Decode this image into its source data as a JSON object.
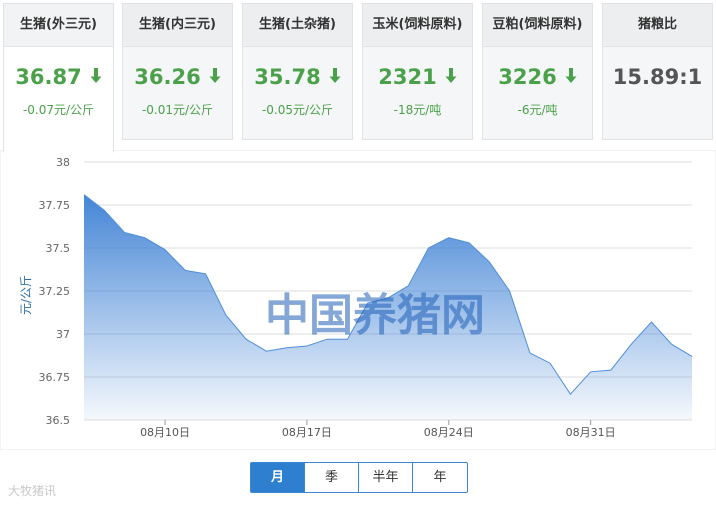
{
  "cards": [
    {
      "title": "生猪(外三元)",
      "value": "36.87",
      "change": "-0.07元/公斤",
      "direction": "down",
      "active": true
    },
    {
      "title": "生猪(内三元)",
      "value": "36.26",
      "change": "-0.01元/公斤",
      "direction": "down"
    },
    {
      "title": "生猪(土杂猪)",
      "value": "35.78",
      "change": "-0.05元/公斤",
      "direction": "down"
    },
    {
      "title": "玉米(饲料原料)",
      "value": "2321",
      "change": "-18元/吨",
      "direction": "down"
    },
    {
      "title": "豆粕(饲料原料)",
      "value": "3226",
      "change": "-6元/吨",
      "direction": "down"
    },
    {
      "title": "猪粮比",
      "ratio": "15.89:1"
    }
  ],
  "colors": {
    "down": "#4aa14a",
    "accent": "#2e7fd0",
    "area_top": "#3b7fd4"
  },
  "chart_data": {
    "type": "area",
    "ylabel": "元/公斤",
    "ylim": [
      36.5,
      38
    ],
    "yticks": [
      "36.5",
      "36.75",
      "37",
      "37.25",
      "37.5",
      "37.75",
      "38"
    ],
    "xticks": [
      {
        "label": "08月10日",
        "x": 5
      },
      {
        "label": "08月17日",
        "x": 12
      },
      {
        "label": "08月24日",
        "x": 19
      },
      {
        "label": "08月31日",
        "x": 26
      }
    ],
    "x": [
      1,
      2,
      3,
      4,
      5,
      6,
      7,
      8,
      9,
      10,
      11,
      12,
      13,
      14,
      15,
      16,
      17,
      18,
      19,
      20,
      21,
      22,
      23,
      24,
      25,
      26,
      27,
      28,
      29,
      30,
      31
    ],
    "values": [
      37.81,
      37.72,
      37.59,
      37.56,
      37.49,
      37.37,
      37.35,
      37.11,
      36.97,
      36.9,
      36.92,
      36.93,
      36.97,
      36.97,
      37.18,
      37.21,
      37.28,
      37.5,
      37.56,
      37.53,
      37.42,
      37.25,
      36.89,
      36.83,
      36.65,
      36.78,
      36.79,
      36.94,
      37.07,
      36.94,
      36.87
    ],
    "grid": true,
    "watermark": "中国养猪网"
  },
  "period_buttons": [
    {
      "label": "月",
      "active": true
    },
    {
      "label": "季"
    },
    {
      "label": "半年"
    },
    {
      "label": "年"
    }
  ],
  "source_watermark": "大牧猪讯"
}
